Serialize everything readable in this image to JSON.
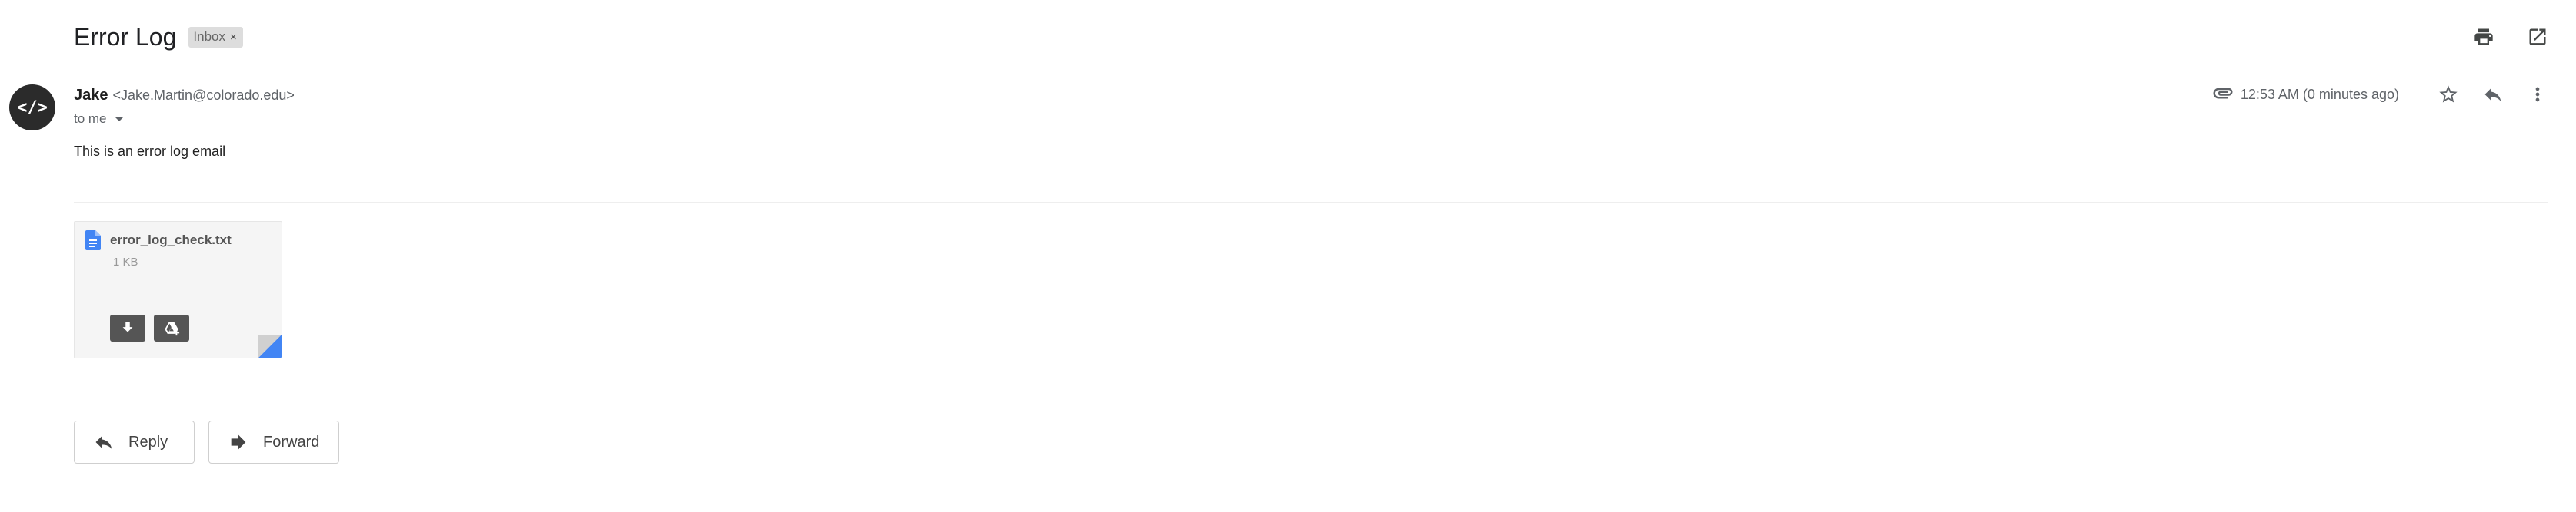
{
  "email": {
    "subject": "Error Log",
    "label": {
      "name": "Inbox",
      "remove_glyph": "×"
    },
    "sender": {
      "name": "Jake",
      "email": "<Jake.Martin@colorado.edu>",
      "avatar_text": "</>"
    },
    "recipient_line": "to me",
    "timestamp": "12:53 AM (0 minutes ago)",
    "body": "This is an error log email"
  },
  "attachment": {
    "filename": "error_log_check.txt",
    "size": "1 KB",
    "icon": "google-docs-icon",
    "actions": [
      "download-icon",
      "add-to-drive-icon"
    ]
  },
  "actions": {
    "reply_label": "Reply",
    "forward_label": "Forward"
  },
  "icons": {
    "top": [
      "print-icon",
      "open-in-new-window-icon"
    ],
    "meta": [
      "attachment-clip-icon",
      "star-icon",
      "reply-icon",
      "more-vert-icon"
    ]
  },
  "colors": {
    "avatar_bg": "#2b2b2b",
    "doc_blue": "#4285f4",
    "attachment_button": "#555555",
    "label_chip_bg": "#dddddd"
  }
}
